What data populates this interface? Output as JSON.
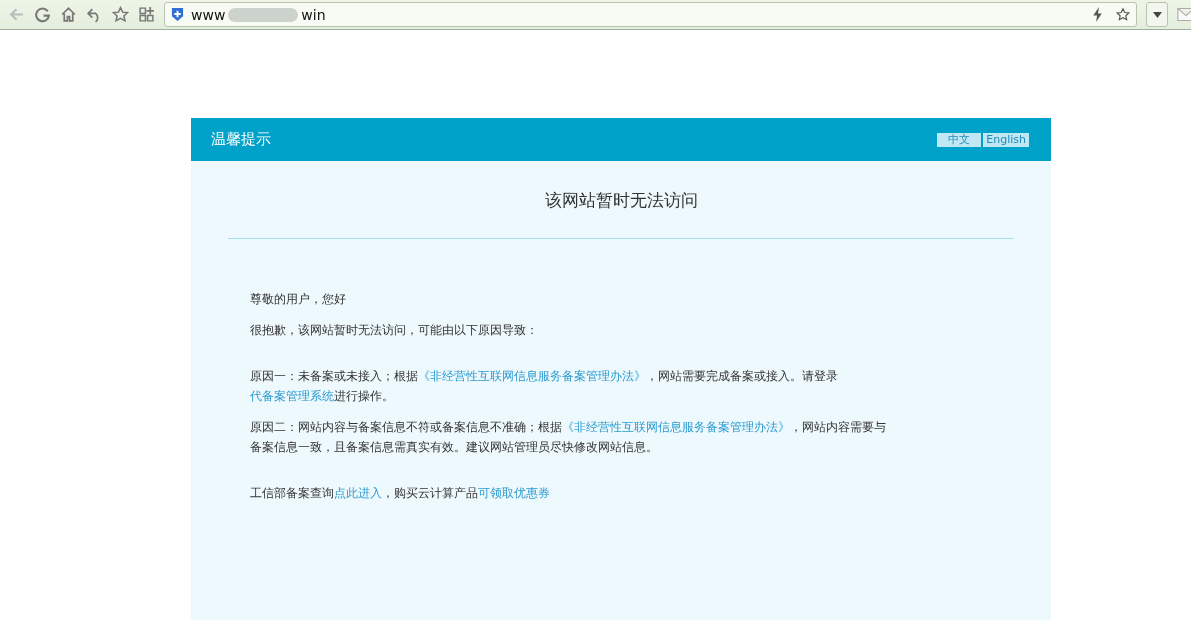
{
  "browser": {
    "url_start": "www",
    "url_end": "win"
  },
  "notice": {
    "title": "温馨提示",
    "languages": [
      {
        "label": "中文"
      },
      {
        "label": "English"
      }
    ],
    "heading": "该网站暂时无法访问",
    "sections": [
      {
        "paragraphs": [
          {
            "segments": [
              {
                "kind": "text",
                "text": "尊敬的用户，您好"
              }
            ]
          },
          {
            "segments": [
              {
                "kind": "text",
                "text": "很抱歉，该网站暂时无法访问，可能由以下原因导致："
              }
            ]
          }
        ]
      },
      {
        "paragraphs": [
          {
            "segments": [
              {
                "kind": "text",
                "text": "原因一：未备案或未接入；根据"
              },
              {
                "kind": "link",
                "text": "《非经营性互联网信息服务备案管理办法》"
              },
              {
                "kind": "text",
                "text": "，网站需要完成备案或接入。请登录"
              },
              {
                "kind": "link",
                "text": "代备案管理系统"
              },
              {
                "kind": "text",
                "text": "进行操作。"
              }
            ]
          },
          {
            "segments": [
              {
                "kind": "text",
                "text": "原因二：网站内容与备案信息不符或备案信息不准确；根据"
              },
              {
                "kind": "link",
                "text": "《非经营性互联网信息服务备案管理办法》"
              },
              {
                "kind": "text",
                "text": "，网站内容需要与备案信息一致，且备案信息需真实有效。建议网站管理员尽快修改网站信息。"
              }
            ]
          }
        ]
      },
      {
        "paragraphs": [
          {
            "segments": [
              {
                "kind": "text",
                "text": "工信部备案查询"
              },
              {
                "kind": "link",
                "text": "点此进入"
              },
              {
                "kind": "text",
                "text": "，购买云计算产品"
              },
              {
                "kind": "link",
                "text": "可领取优惠券"
              }
            ]
          }
        ]
      }
    ]
  }
}
